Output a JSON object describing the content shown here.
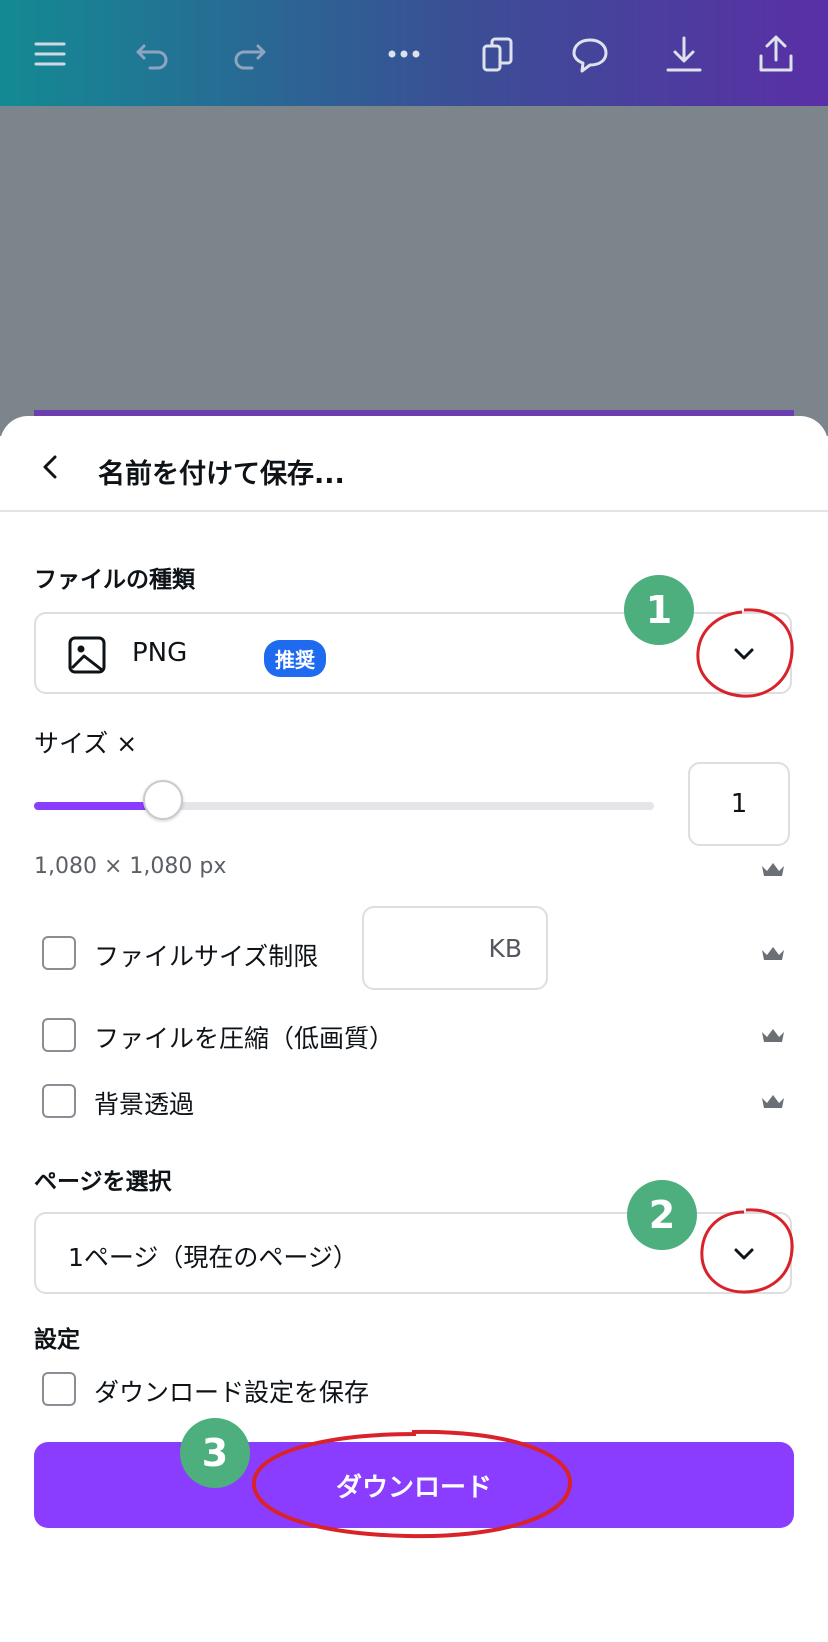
{
  "toolbar": {
    "icons": [
      "menu-icon",
      "undo-icon",
      "redo-icon",
      "more-icon",
      "pages-icon",
      "comment-icon",
      "download-icon",
      "share-icon"
    ]
  },
  "dialog": {
    "title": "名前を付けて保存...",
    "file_type_label": "ファイルの種類",
    "file_type_value": "PNG",
    "recommended_badge": "推奨",
    "size_label": "サイズ ×",
    "size_value": "1",
    "size_slider_fraction": 0.2,
    "dimensions": "1,080 × 1,080 px",
    "options": [
      {
        "label": "ファイルサイズ制限",
        "checked": false
      },
      {
        "label": "ファイルを圧縮（低画質）",
        "checked": false
      },
      {
        "label": "背景透過",
        "checked": false
      }
    ],
    "kb_unit": "KB",
    "page_select_label": "ページを選択",
    "page_select_value": "1ページ（現在のページ）",
    "settings_label": "設定",
    "save_settings_label": "ダウンロード設定を保存",
    "download_button": "ダウンロード"
  },
  "annotations": {
    "markers": [
      "1",
      "2",
      "3"
    ],
    "marker_color": "#4caf7d",
    "circle_color": "#d9232a"
  },
  "colors": {
    "accent": "#8b3dff",
    "badge": "#1e6bf0"
  }
}
